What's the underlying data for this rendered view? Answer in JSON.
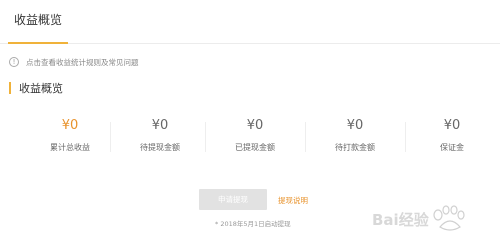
{
  "tabs": {
    "active": "收益概览"
  },
  "notice": {
    "icon": "info-icon",
    "text": "点击查看收益统计规则及常见问题"
  },
  "section": {
    "title": "收益概览"
  },
  "stats": [
    {
      "value": "¥0",
      "label": "累计总收益",
      "highlight": true
    },
    {
      "value": "¥0",
      "label": "待提现金额",
      "highlight": false
    },
    {
      "value": "¥0",
      "label": "已提现金额",
      "highlight": false
    },
    {
      "value": "¥0",
      "label": "待打款金额",
      "highlight": false
    },
    {
      "value": "¥0",
      "label": "保证金",
      "highlight": false
    }
  ],
  "actions": {
    "apply_label": "申请提现",
    "rules_label": "提现说明",
    "note": "* 2018年5月1日启动提现"
  },
  "watermark": {
    "text": "Bai经验"
  },
  "colors": {
    "accent": "#f0b23a",
    "highlight": "#e8932d",
    "disabled": "#e2e2e2"
  }
}
